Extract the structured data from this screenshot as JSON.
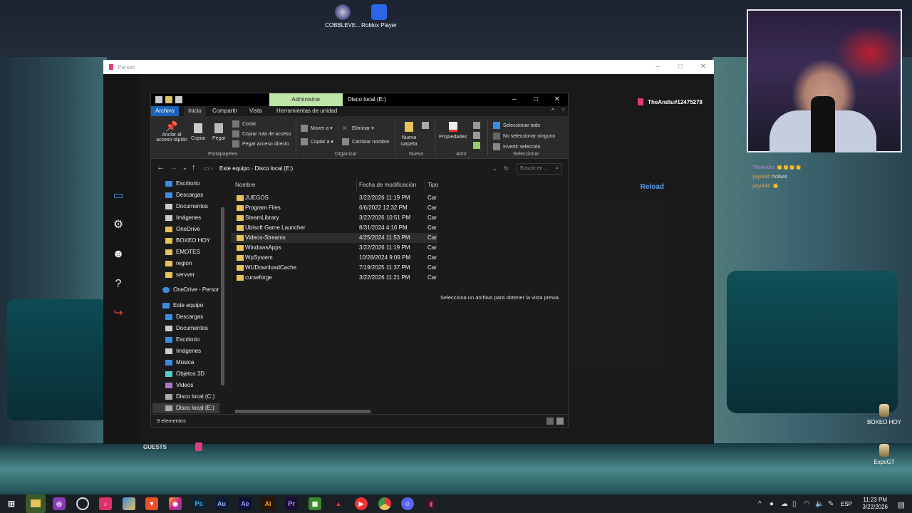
{
  "desktop": {
    "icons": [
      {
        "label": "COBBLEVE..."
      },
      {
        "label": "Roblox Player"
      },
      {
        "label": "BOXEO HOY"
      },
      {
        "label": "ExpoGT"
      }
    ]
  },
  "chat": {
    "lines": [
      {
        "user": "TheAndiu:",
        "text": "👏👏👏👏"
      },
      {
        "user": "yayui34:",
        "text": "holiwis"
      },
      {
        "user": "yayui34:",
        "text": "👏"
      }
    ]
  },
  "parsec": {
    "title": "Parsec",
    "user": "TheAndiu#12475278",
    "reload": "Reload",
    "guests": "GUESTS"
  },
  "explorer": {
    "title": "Disco local (E:)",
    "admin_tab": "Administrar",
    "tabs": [
      "Archivo",
      "Inicio",
      "Compartir",
      "Vista",
      "Herramientas de unidad"
    ],
    "ribbon": {
      "pin": "Anclar al acceso rápido",
      "copy": "Copiar",
      "paste": "Pegar",
      "cut": "Cortar",
      "copy_path": "Copiar ruta de acceso",
      "paste_shortcut": "Pegar acceso directo",
      "move_to": "Mover a",
      "copy_to": "Copiar a",
      "delete": "Eliminar",
      "rename": "Cambiar nombre",
      "new_folder": "Nueva carpeta",
      "properties": "Propiedades",
      "select_all": "Seleccionar todo",
      "select_none": "No seleccionar ninguno",
      "invert": "Invertir selección",
      "groups": [
        "Portapapeles",
        "Organizar",
        "Nuevo",
        "Abrir",
        "Seleccionar"
      ]
    },
    "breadcrumb": [
      "Este equipo",
      "Disco local (E:)"
    ],
    "search_placeholder": "Buscar en ...",
    "nav": [
      {
        "label": "Escritorio",
        "pinned": true
      },
      {
        "label": "Descargas",
        "pinned": true
      },
      {
        "label": "Documentos",
        "pinned": true
      },
      {
        "label": "Imágenes",
        "pinned": true
      },
      {
        "label": "OneDrive",
        "pinned": true
      },
      {
        "label": "BOXEO HOY"
      },
      {
        "label": "EMOTES"
      },
      {
        "label": "region"
      },
      {
        "label": "servver"
      },
      {
        "label": "OneDrive - Persor"
      },
      {
        "label": "Este equipo"
      },
      {
        "label": "Descargas"
      },
      {
        "label": "Documentos"
      },
      {
        "label": "Escritorio"
      },
      {
        "label": "Imágenes"
      },
      {
        "label": "Música"
      },
      {
        "label": "Objetos 3D"
      },
      {
        "label": "Videos"
      },
      {
        "label": "Disco local (C:)"
      },
      {
        "label": "Disco local (E:)"
      }
    ],
    "columns": {
      "name": "Nombre",
      "date": "Fecha de modificación",
      "type": "Tipo"
    },
    "files": [
      {
        "name": "JUEGOS",
        "date": "3/22/2026 11:19 PM",
        "type": "Car"
      },
      {
        "name": "Program Files",
        "date": "6/6/2022 12:32 PM",
        "type": "Car"
      },
      {
        "name": "SteamLibrary",
        "date": "3/22/2026 10:51 PM",
        "type": "Car"
      },
      {
        "name": "Ubisoft Game Launcher",
        "date": "8/31/2024 4:16 PM",
        "type": "Car"
      },
      {
        "name": "Videos-Streams",
        "date": "4/25/2024 11:53 PM",
        "type": "Car"
      },
      {
        "name": "WindowsApps",
        "date": "3/22/2026 11:19 PM",
        "type": "Car"
      },
      {
        "name": "WpSystem",
        "date": "10/28/2024 9:09 PM",
        "type": "Car"
      },
      {
        "name": "WUDownloadCache",
        "date": "7/19/2025 11:37 PM",
        "type": "Car"
      },
      {
        "name": "curseforge",
        "date": "3/22/2026 11:21 PM",
        "type": "Car"
      }
    ],
    "preview_text": "Selecciona un archivo para obtener la vista previa.",
    "status": "9 elementos"
  },
  "taskbar": {
    "apps": [
      "start",
      "explorer",
      "podcasts",
      "chrome-alt",
      "tiktok",
      "copilot",
      "brave",
      "instagram",
      "Ps",
      "Au",
      "Ae",
      "Ai",
      "Pr",
      "minecraft",
      "adobe",
      "youtube",
      "chrome",
      "discord",
      "parsec"
    ],
    "lang": "ESP",
    "time": "11:23 PM",
    "date": "3/22/2026"
  }
}
